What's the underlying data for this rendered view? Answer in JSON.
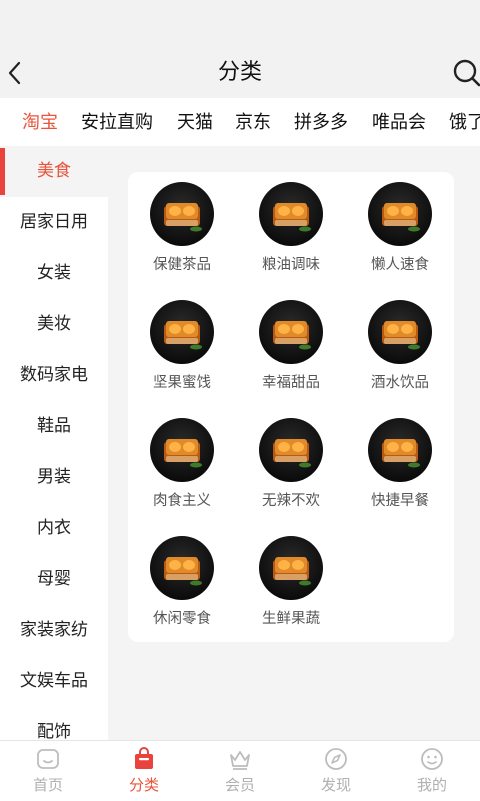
{
  "header": {
    "title": "分类",
    "back_icon": "chevron-left-icon",
    "search_icon": "search-icon"
  },
  "platform_tabs": [
    {
      "label": "淘宝",
      "active": true
    },
    {
      "label": "安拉直购",
      "active": false
    },
    {
      "label": "天猫",
      "active": false
    },
    {
      "label": "京东",
      "active": false
    },
    {
      "label": "拼多多",
      "active": false
    },
    {
      "label": "唯品会",
      "active": false
    },
    {
      "label": "饿了",
      "active": false
    }
  ],
  "sidebar": {
    "items": [
      {
        "label": "美食",
        "active": true
      },
      {
        "label": "居家日用",
        "active": false
      },
      {
        "label": "女装",
        "active": false
      },
      {
        "label": "美妆",
        "active": false
      },
      {
        "label": "数码家电",
        "active": false
      },
      {
        "label": "鞋品",
        "active": false
      },
      {
        "label": "男装",
        "active": false
      },
      {
        "label": "内衣",
        "active": false
      },
      {
        "label": "母婴",
        "active": false
      },
      {
        "label": "家装家纺",
        "active": false
      },
      {
        "label": "文娱车品",
        "active": false
      },
      {
        "label": "配饰",
        "active": false
      }
    ]
  },
  "subcategories": [
    {
      "label": "保健茶品"
    },
    {
      "label": "粮油调味"
    },
    {
      "label": "懒人速食"
    },
    {
      "label": "坚果蜜饯"
    },
    {
      "label": "幸福甜品"
    },
    {
      "label": "酒水饮品"
    },
    {
      "label": "肉食主义"
    },
    {
      "label": "无辣不欢"
    },
    {
      "label": "快捷早餐"
    },
    {
      "label": "休闲零食"
    },
    {
      "label": "生鲜果蔬"
    }
  ],
  "bottom_nav": [
    {
      "label": "首页",
      "icon": "home-icon",
      "active": false
    },
    {
      "label": "分类",
      "icon": "shopping-bag-icon",
      "active": true
    },
    {
      "label": "会员",
      "icon": "crown-icon",
      "active": false
    },
    {
      "label": "发现",
      "icon": "compass-icon",
      "active": false
    },
    {
      "label": "我的",
      "icon": "smiley-face-icon",
      "active": false
    }
  ],
  "colors": {
    "accent": "#e8543c",
    "indicator": "#e8433c",
    "background": "#f4f4f4",
    "inactive_nav": "#b0b0b0"
  }
}
